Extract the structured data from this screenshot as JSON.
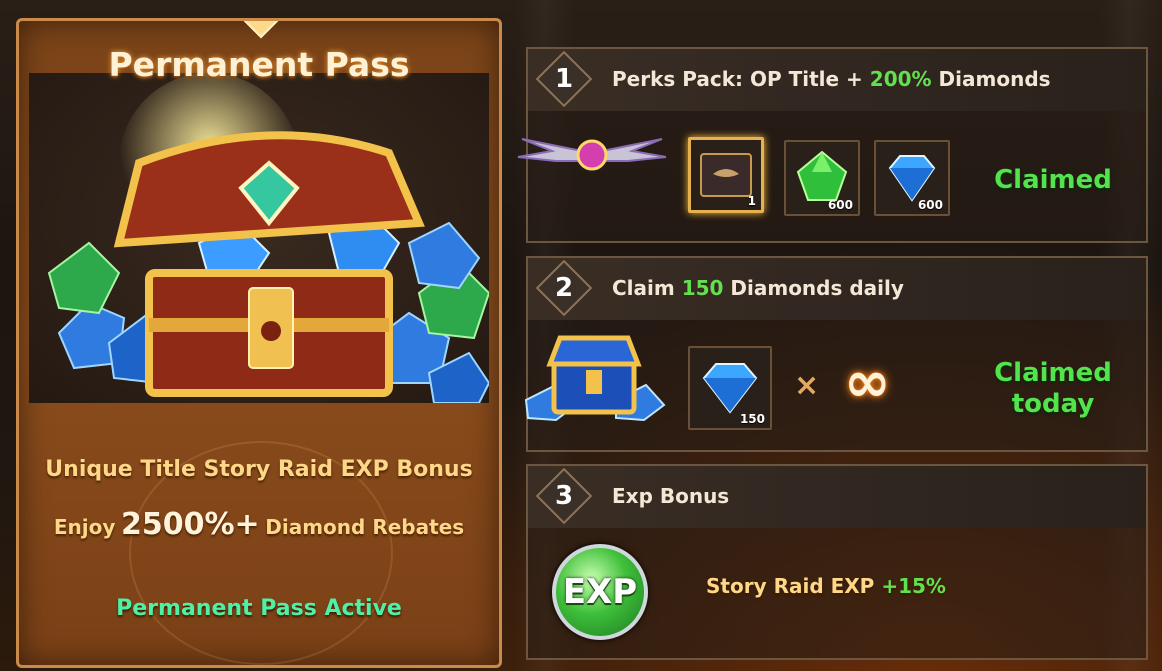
{
  "left_panel": {
    "title": "Permanent Pass",
    "line1": "Unique Title  Story Raid EXP Bonus",
    "line2_pre": "Enjoy",
    "line2_big": "2500%+",
    "line2_post": "Diamond Rebates",
    "line3": "Permanent Pass Active"
  },
  "rows": [
    {
      "number": "1",
      "title_pre": "Perks Pack: OP Title + ",
      "title_highlight": "200%",
      "title_post": " Diamonds",
      "items": [
        {
          "icon": "title-scroll-icon",
          "count": "1"
        },
        {
          "icon": "green-gem-icon",
          "count": "600"
        },
        {
          "icon": "blue-diamond-icon",
          "count": "600"
        }
      ],
      "status": "Claimed"
    },
    {
      "number": "2",
      "title_pre": "Claim ",
      "title_highlight": "150",
      "title_post": " Diamonds daily",
      "items": [
        {
          "icon": "blue-diamond-icon",
          "count": "150"
        }
      ],
      "multiply": "×",
      "infinity": "∞",
      "status_line1": "Claimed",
      "status_line2": "today"
    },
    {
      "number": "3",
      "title": "Exp Bonus",
      "badge": "EXP",
      "bonus_label": "Story Raid EXP",
      "bonus_value": "+15%"
    }
  ],
  "colors": {
    "highlight_green": "#63e04e",
    "active_teal": "#4ff0a6",
    "gold_text": "#ffd788"
  }
}
